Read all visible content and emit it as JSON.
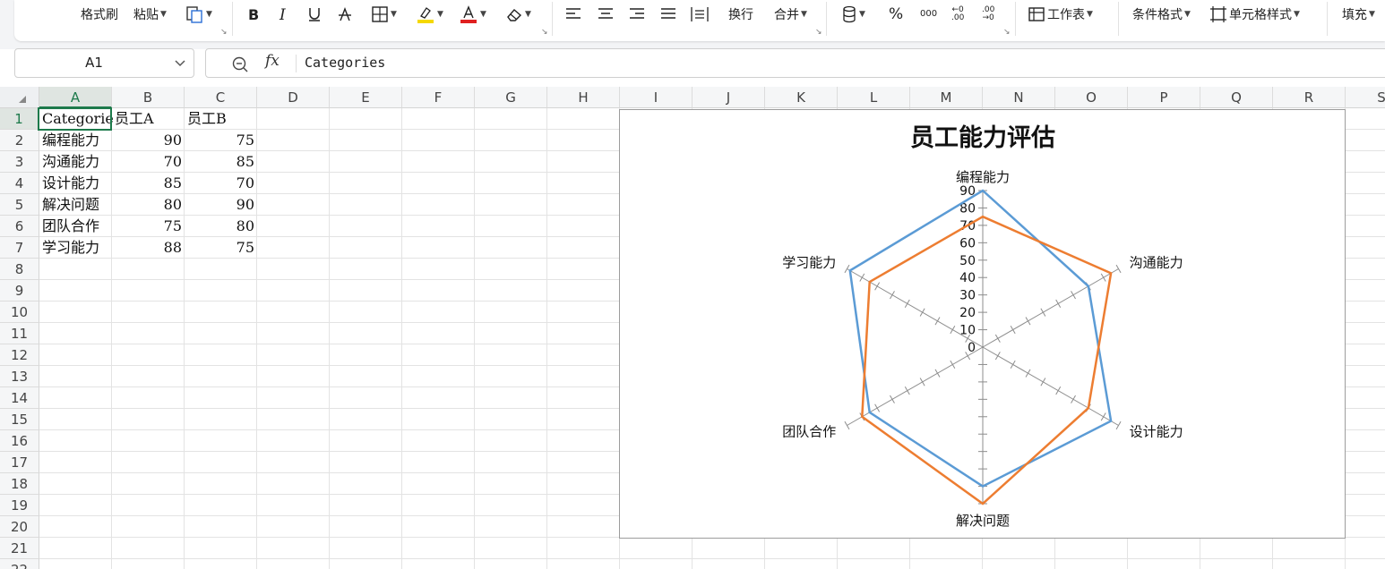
{
  "toolbar": {
    "format_painter": "格式刷",
    "paste": "粘贴",
    "wrap": "换行",
    "merge": "合并",
    "percent": "%",
    "thousands": "000",
    "decimal_increase": "←0\n.00",
    "decimal_decrease": ".00\n→0",
    "worksheet": "工作表",
    "conditional_format": "条件格式",
    "cell_style": "单元格样式",
    "fill": "填充",
    "font_color": "#e02020",
    "highlight_color": "#f5d800"
  },
  "formula_bar": {
    "name_box": "A1",
    "fx": "fx",
    "content": "Categories"
  },
  "columns": [
    "A",
    "B",
    "C",
    "D",
    "E",
    "F",
    "G",
    "H",
    "I",
    "J",
    "K",
    "L",
    "M",
    "N",
    "O",
    "P",
    "Q",
    "R",
    "S"
  ],
  "rows": [
    "1",
    "2",
    "3",
    "4",
    "5",
    "6",
    "7",
    "8",
    "9",
    "10",
    "11",
    "12",
    "13",
    "14",
    "15",
    "16",
    "17",
    "18",
    "19",
    "20",
    "21",
    "22"
  ],
  "selected_cell": "A1",
  "sheet": {
    "header": [
      "Categories",
      "员工A",
      "员工B"
    ],
    "data": [
      [
        "编程能力",
        "90",
        "75"
      ],
      [
        "沟通能力",
        "70",
        "85"
      ],
      [
        "设计能力",
        "85",
        "70"
      ],
      [
        "解决问题",
        "80",
        "90"
      ],
      [
        "团队合作",
        "75",
        "80"
      ],
      [
        "学习能力",
        "88",
        "75"
      ]
    ]
  },
  "chart_data": {
    "type": "radar",
    "title": "员工能力评估",
    "categories": [
      "编程能力",
      "沟通能力",
      "设计能力",
      "解决问题",
      "团队合作",
      "学习能力"
    ],
    "series": [
      {
        "values": [
          90,
          70,
          85,
          80,
          75,
          88
        ],
        "color": "#5b9bd5"
      },
      {
        "values": [
          75,
          85,
          70,
          90,
          80,
          75
        ],
        "color": "#ed7d31"
      }
    ],
    "axis_ticks": [
      "0",
      "10",
      "20",
      "30",
      "40",
      "50",
      "60",
      "70",
      "80",
      "90"
    ],
    "axis_max": 90,
    "legend": "none"
  }
}
